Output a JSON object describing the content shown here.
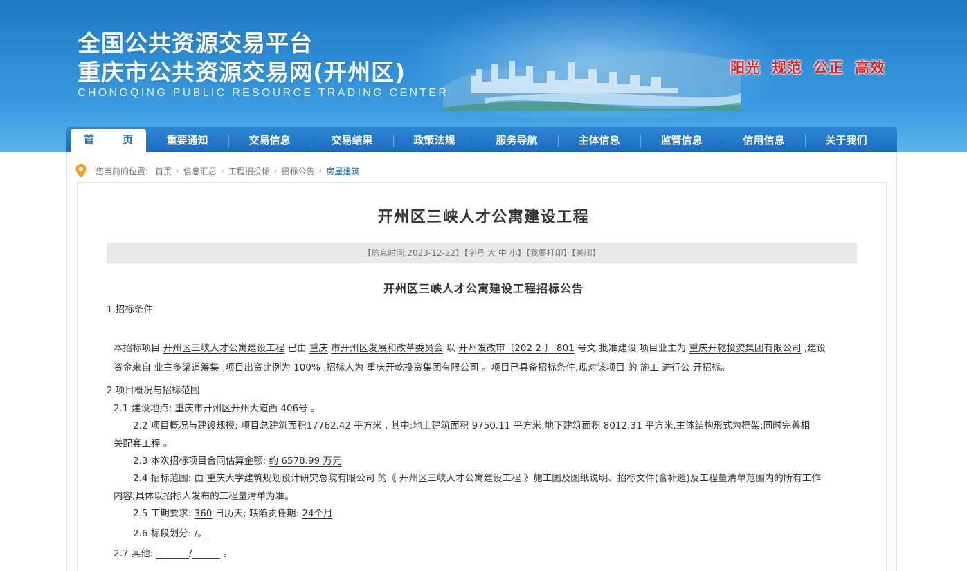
{
  "header": {
    "title_line1": "全国公共资源交易平台",
    "title_line2": "重庆市公共资源交易网(开州区)",
    "title_en": "CHONGQING PUBLIC RESOURCE TRADING CENTER",
    "slogans": [
      "阳光",
      "规范",
      "公正",
      "高效"
    ]
  },
  "nav": {
    "items": [
      "首 页",
      "重要通知",
      "交易信息",
      "交易结果",
      "政策法规",
      "服务导航",
      "主体信息",
      "监管信息",
      "信用信息",
      "关于我们"
    ],
    "active_index": 0
  },
  "breadcrumb": {
    "prefix": "您当前的位置:",
    "items": [
      "首页",
      "信息汇总",
      "工程招投标",
      "招标公告",
      "房屋建筑"
    ]
  },
  "article": {
    "title": "开州区三峡人才公寓建设工程",
    "meta": {
      "time_label": "【信息时间:2023-12-22】",
      "font_label": "【字号",
      "font_big": "大",
      "font_mid": "中",
      "font_small": "小】",
      "print": "【我要打印】",
      "close": "【关闭】"
    },
    "doc_title": "开州区三峡人才公寓建设工程招标公告",
    "s1_heading": "1.招标条件",
    "p1": {
      "t1": "本招标项目 ",
      "project": "开州区三峡人才公寓建设工程",
      "t2": " 已由 ",
      "authority1": "重庆",
      "t3": " ",
      "authority2": "市开州区发展和改革委员会",
      "t4": " 以 ",
      "doc_no": "开州发改审〔202 2 〕 801",
      "t5": " 号文 批准建设,项目业主为 ",
      "owner": "重庆开乾投资集团有限公司",
      "t6": " ,建设",
      "t7": "资金来自 ",
      "funding": "业主多渠道筹集",
      "t8": " ,项目出资比例为 ",
      "ratio": "100%",
      "t9": " ,招标人为 ",
      "tenderer": "重庆开乾投资集团有限公司",
      "t10": " 。项目已具备招标条件,现对该项目 的 ",
      "scope": "施工",
      "t11": " 进行公 开招标。"
    },
    "s2_heading": "2.项目概况与招标范围",
    "s2_1": "2.1 建设地点: 重庆市开州区开州大道西 406号 。",
    "s2_2a": "2.2 项目概况与建设规模: 项目总建筑面积17762.42 平方米 , 其中:地上建筑面积 9750.11 平方米,地下建筑面积 8012.31 平方米,主体结构形式为框架:同时完善相",
    "s2_2b": "关配套工程 。",
    "s2_3": {
      "label": "2.3  本次招标项目合同估算金额: ",
      "value": "约 6578.99 万元"
    },
    "s2_4a": "2.4 招标范围: 由 重庆大学建筑规划设计研究总院有限公司 的《 开州区三峡人才公寓建设工程 》施工图及图纸说明、招标文件(含补遗)及工程量清单范围内的所有工作",
    "s2_4b": "内容,具体以招标人发布的工程量清单为准。",
    "s2_5": {
      "label": "2.5 工期要求: ",
      "days": "360",
      "mid": " 日历天; 缺陷责任期: ",
      "period": "24个月"
    },
    "s2_6": {
      "label": "2.6 标段划分: ",
      "value": "/。"
    },
    "s2_7": {
      "label": "2.7 其他: ",
      "value": "_______/______",
      "end": " 。"
    }
  }
}
